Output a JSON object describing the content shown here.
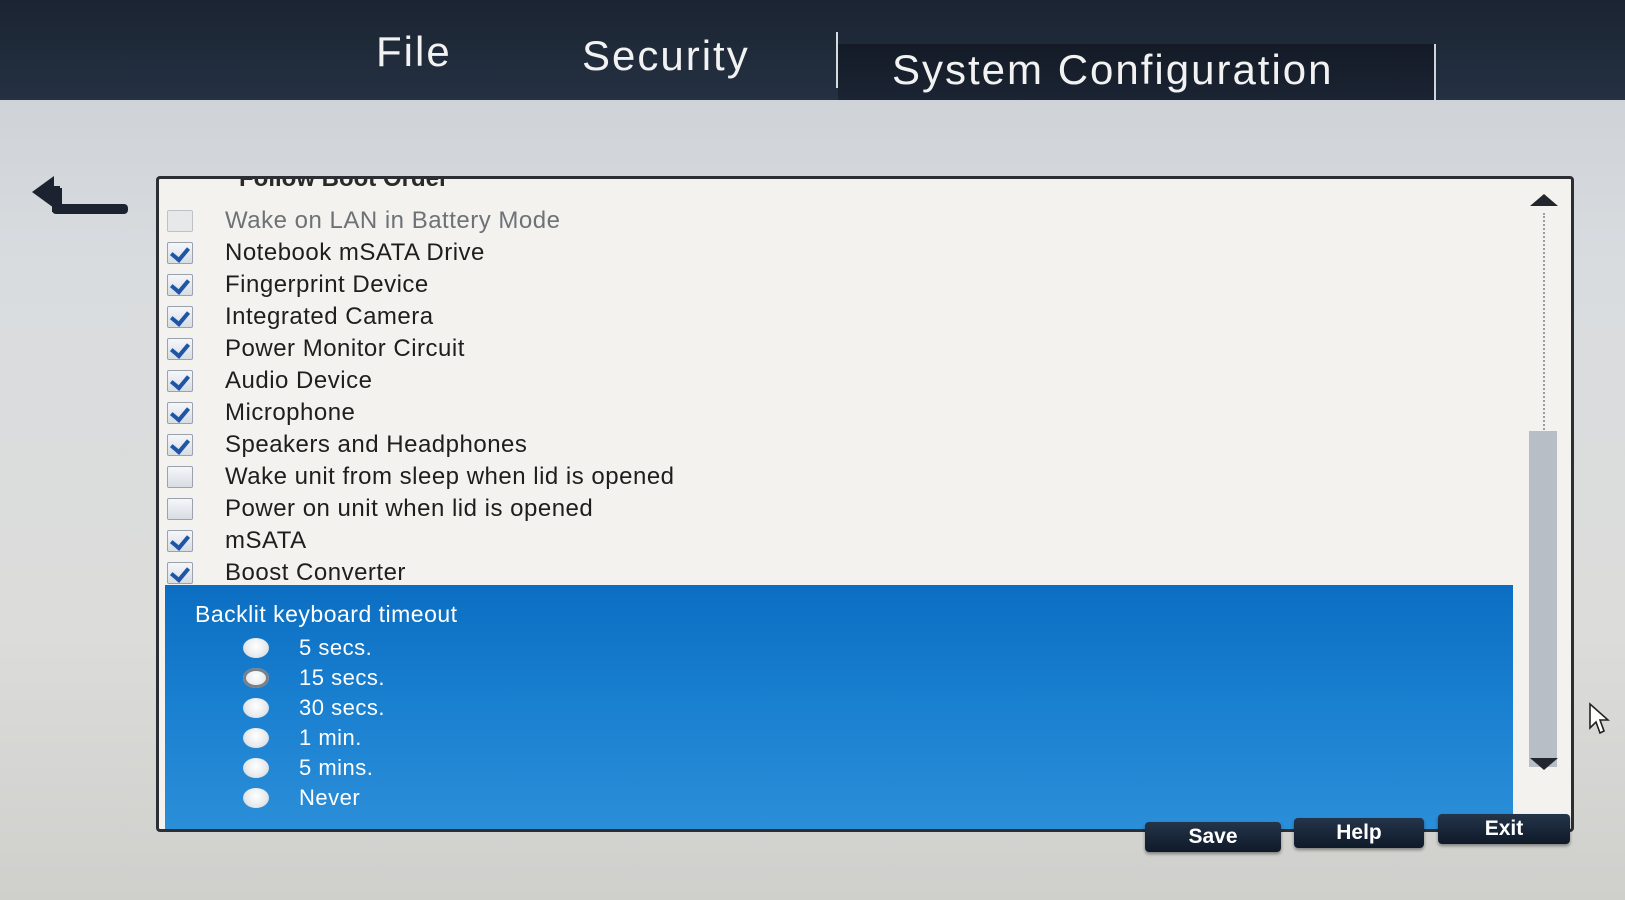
{
  "tabs": {
    "file": "File",
    "security": "Security",
    "system_configuration": "System Configuration"
  },
  "partial_item": {
    "label": "Follow Boot Order"
  },
  "devices": [
    {
      "label": "Wake on LAN in Battery Mode",
      "checked": false,
      "disabled": true
    },
    {
      "label": "Notebook mSATA Drive",
      "checked": true,
      "disabled": false
    },
    {
      "label": "Fingerprint Device",
      "checked": true,
      "disabled": false
    },
    {
      "label": "Integrated Camera",
      "checked": true,
      "disabled": false
    },
    {
      "label": "Power Monitor Circuit",
      "checked": true,
      "disabled": false
    },
    {
      "label": "Audio Device",
      "checked": true,
      "disabled": false
    },
    {
      "label": "Microphone",
      "checked": true,
      "disabled": false
    },
    {
      "label": "Speakers and Headphones",
      "checked": true,
      "disabled": false
    },
    {
      "label": "Wake unit from sleep when lid is opened",
      "checked": false,
      "disabled": false
    },
    {
      "label": "Power on unit when lid is opened",
      "checked": false,
      "disabled": false
    },
    {
      "label": "mSATA",
      "checked": true,
      "disabled": false
    },
    {
      "label": "Boost Converter",
      "checked": true,
      "disabled": false
    }
  ],
  "backlit": {
    "title": "Backlit keyboard timeout",
    "options": [
      {
        "label": "5 secs.",
        "selected": false
      },
      {
        "label": "15 secs.",
        "selected": true
      },
      {
        "label": "30 secs.",
        "selected": false
      },
      {
        "label": "1 min.",
        "selected": false
      },
      {
        "label": "5 mins.",
        "selected": false
      },
      {
        "label": "Never",
        "selected": false
      }
    ]
  },
  "buttons": {
    "save": "Save",
    "help": "Help",
    "exit": "Exit"
  },
  "colors": {
    "topbar": "#1b2432",
    "highlight": "#1a80d0",
    "checkmark": "#1f55a8"
  },
  "icons": {
    "back": "back-arrow-icon",
    "scroll_up": "triangle-up-icon",
    "scroll_down": "triangle-down-icon",
    "cursor": "mouse-pointer-icon"
  }
}
